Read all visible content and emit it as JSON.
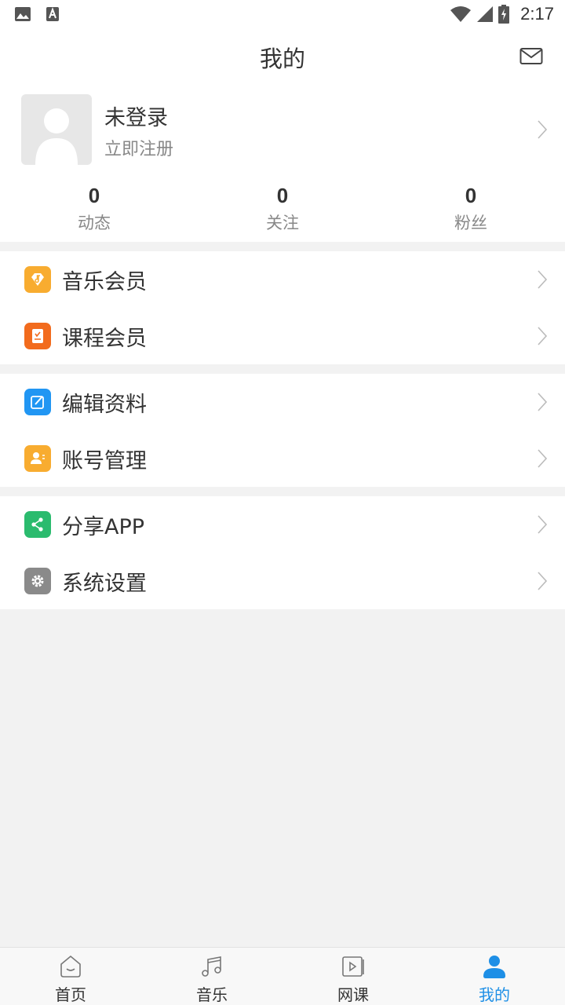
{
  "status_bar": {
    "time": "2:17"
  },
  "header": {
    "title": "我的"
  },
  "profile": {
    "name": "未登录",
    "subtitle": "立即注册"
  },
  "stats": [
    {
      "value": "0",
      "label": "动态"
    },
    {
      "value": "0",
      "label": "关注"
    },
    {
      "value": "0",
      "label": "粉丝"
    }
  ],
  "menu_groups": [
    [
      {
        "label": "音乐会员",
        "icon": "diamond-music-icon",
        "color": "#f8ac30"
      },
      {
        "label": "课程会员",
        "icon": "book-icon",
        "color": "#f26b1d"
      }
    ],
    [
      {
        "label": "编辑资料",
        "icon": "edit-icon",
        "color": "#2196f3"
      },
      {
        "label": "账号管理",
        "icon": "account-icon",
        "color": "#f8ac30"
      }
    ],
    [
      {
        "label": "分享APP",
        "icon": "share-icon",
        "color": "#2bbb6e"
      },
      {
        "label": "系统设置",
        "icon": "gear-icon",
        "color": "#8a8a8a"
      }
    ]
  ],
  "tabbar": [
    {
      "label": "首页",
      "icon": "home-icon",
      "active": false
    },
    {
      "label": "音乐",
      "icon": "music-note-icon",
      "active": false
    },
    {
      "label": "网课",
      "icon": "video-play-icon",
      "active": false
    },
    {
      "label": "我的",
      "icon": "user-icon",
      "active": true
    }
  ],
  "colors": {
    "accent": "#1e8fe6",
    "background": "#f2f2f2"
  }
}
